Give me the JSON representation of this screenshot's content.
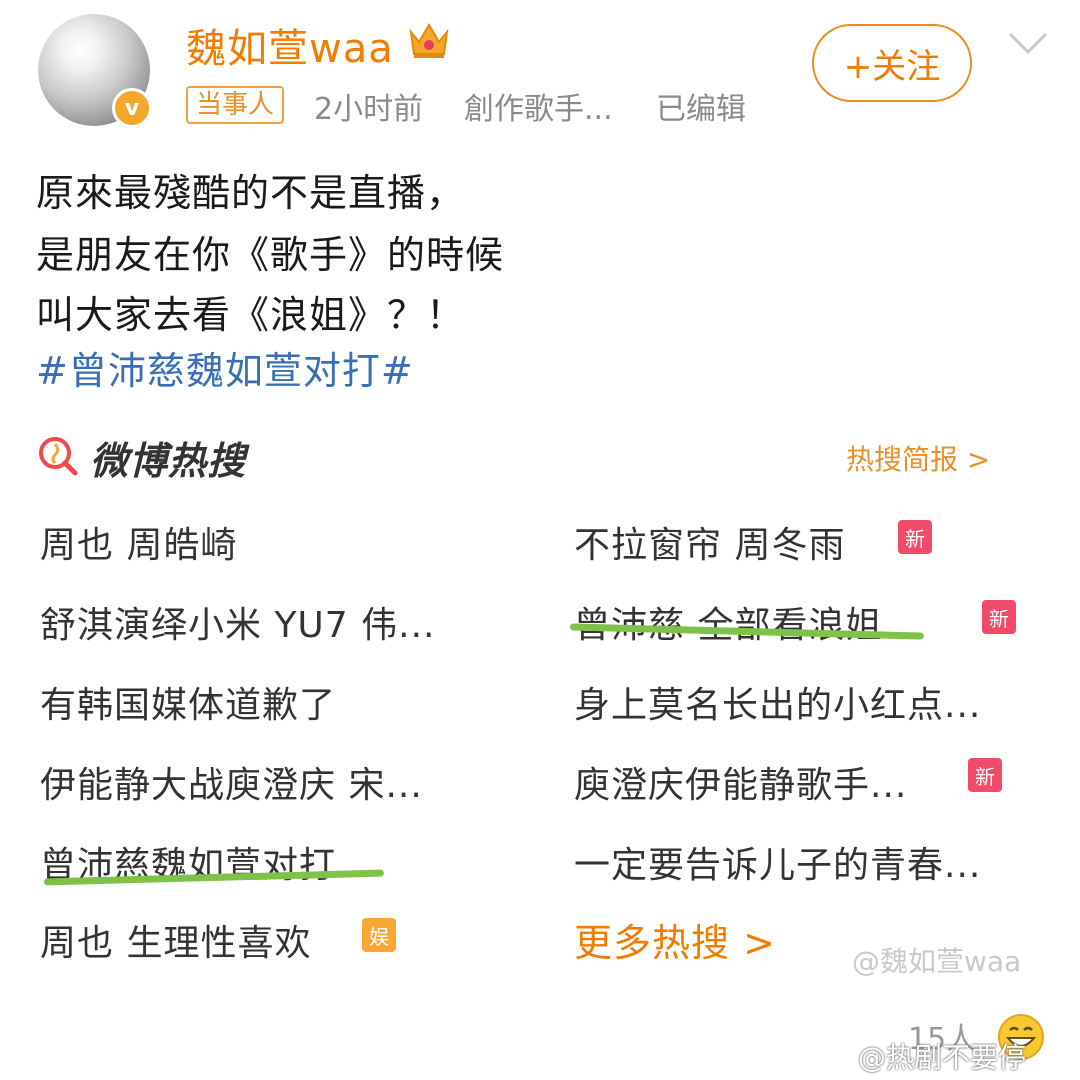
{
  "profile": {
    "username": "魏如萱waa",
    "tag": "当事人",
    "time": "2小时前",
    "source": "創作歌手...",
    "edited": "已编辑",
    "follow_label": "+关注",
    "verify_mark": "v"
  },
  "post": {
    "lines": [
      "原來最殘酷的不是直播，",
      "是朋友在你《歌手》的時候",
      "叫大家去看《浪姐》？！"
    ],
    "hashtag": "#曾沛慈魏如萱对打#"
  },
  "hot_search": {
    "title": "微博热搜",
    "brief_label": "热搜简报 >",
    "left_items": [
      {
        "text": "周也 周皓崎"
      },
      {
        "text": "舒淇演绎小米 YU7 伟..."
      },
      {
        "text": "有韩国媒体道歉了"
      },
      {
        "text": "伊能静大战庾澄庆 宋..."
      },
      {
        "text": "曾沛慈魏如萱对打"
      },
      {
        "text": "周也 生理性喜欢",
        "badge": "娱"
      }
    ],
    "right_items": [
      {
        "text": "不拉窗帘 周冬雨",
        "badge": "新"
      },
      {
        "text": "曾沛慈 全部看浪姐...",
        "badge": "新"
      },
      {
        "text": "身上莫名长出的小红点..."
      },
      {
        "text": "庾澄庆伊能静歌手...",
        "badge": "新"
      },
      {
        "text": "一定要告诉儿子的青春..."
      }
    ],
    "more_label": "更多热搜 >"
  },
  "footer": {
    "count": "15人",
    "watermark_inner": "@魏如萱waa",
    "watermark_bottom": "@热剧不要停"
  },
  "colors": {
    "accent": "#f07c00",
    "hashtag": "#3a6fb5",
    "badge_new": "#f24a6b",
    "badge_ent": "#f8a732",
    "highlight": "#7fc24a"
  }
}
